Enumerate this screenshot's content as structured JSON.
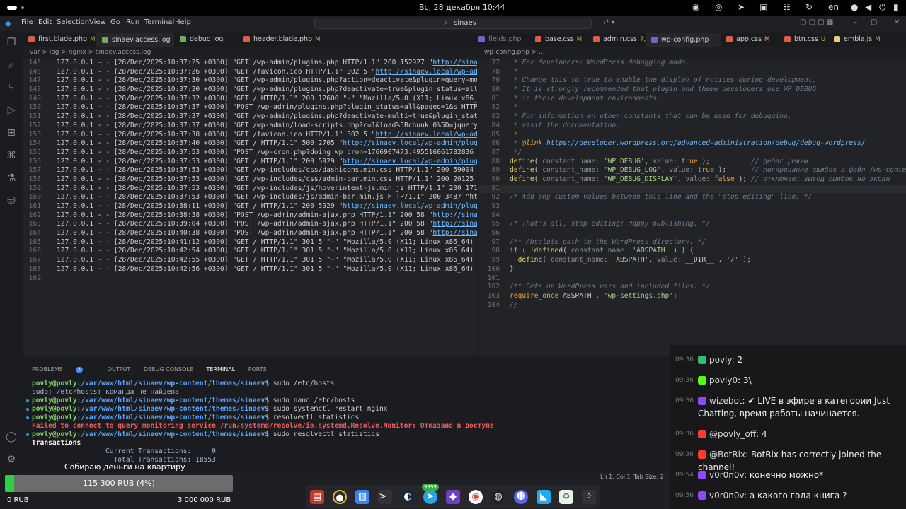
{
  "topbar": {
    "clock": "Вс, 28 декабря  10:44",
    "lang": "en"
  },
  "menu": [
    "File",
    "Edit",
    "Selection",
    "View",
    "Go",
    "Run",
    "Terminal",
    "Help"
  ],
  "search": {
    "text": "sinaev"
  },
  "tabs": [
    {
      "label": "first.blade.php",
      "mark": "M",
      "color": "#e05d44"
    },
    {
      "label": "sinaev.access.log",
      "mark": "",
      "color": "#7aa85a",
      "active": true
    },
    {
      "label": "debug.log",
      "mark": "",
      "color": "#7aa85a"
    },
    {
      "label": "header.blade.php",
      "mark": "M",
      "color": "#e05d44"
    },
    {
      "label": "fields.php",
      "mark": "",
      "color": "#7b5fc4"
    },
    {
      "label": "base.css",
      "mark": "M",
      "color": "#e05d44"
    },
    {
      "label": "admin.css",
      "mark": "7, M",
      "color": "#e05d44"
    },
    {
      "label": "wp-config.php",
      "mark": "",
      "color": "#7b5fc4",
      "active": true
    },
    {
      "label": "app.css",
      "mark": "M",
      "color": "#e05d44"
    },
    {
      "label": "btn.css",
      "mark": "U",
      "color": "#e05d44"
    },
    {
      "label": "embla.js",
      "mark": "M",
      "color": "#e8d06a"
    }
  ],
  "breadcrumb_left": "var  >  log  >  nginx  >  sinaev.access.log",
  "breadcrumb_right": "wp-config.php  >  ...",
  "log": {
    "start": 145,
    "lines": [
      "127.0.0.1 - - [28/Dec/2025:10:37:25 +0300] \"GET /wp-admin/plugins.php HTTP/1.1\" 200 152927 \"http://sinae",
      "127.0.0.1 - - [28/Dec/2025:10:37:26 +0300] \"GET /favicon.ico HTTP/1.1\" 302 5 \"http://sinaev.local/wp-adm",
      "127.0.0.1 - - [28/Dec/2025:10:37:30 +0300] \"GET /wp-admin/plugins.php?action=deactivate&plugin=query-mon",
      "127.0.0.1 - - [28/Dec/2025:10:37:30 +0300] \"GET /wp-admin/plugins.php?deactivate=true&plugin_status=all&",
      "127.0.0.1 - - [28/Dec/2025:10:37:32 +0300] \"GET / HTTP/1.1\" 200 12600 \"-\" \"Mozilla/5.0 (X11; Linux x86_6",
      "127.0.0.1 - - [28/Dec/2025:10:37:37 +0300] \"POST /wp-admin/plugins.php?plugin_status=all&paged=1&s HTTP/1.",
      "127.0.0.1 - - [28/Dec/2025:10:37:37 +0300] \"GET /wp-admin/plugins.php?deactivate-multi=true&plugin_statu",
      "127.0.0.1 - - [28/Dec/2025:10:37:37 +0300] \"GET /wp-admin/load-scripts.php?c=1&load%5Bchunk_0%5D=jquery-",
      "127.0.0.1 - - [28/Dec/2025:10:37:38 +0300] \"GET /favicon.ico HTTP/1.1\" 302 5 \"http://sinaev.local/wp-adm",
      "127.0.0.1 - - [28/Dec/2025:10:37:40 +0300] \"GET / HTTP/1.1\" 500 2705 \"http://sinaev.local/wp-admin/plug",
      "127.0.0.1 - - [28/Dec/2025:10:37:53 +0300] \"POST /wp-cron.php?doing_wp_cron=1766907473.495516061782836",
      "127.0.0.1 - - [28/Dec/2025:10:37:53 +0300] \"GET / HTTP/1.1\" 200 5929 \"http://sinaev.local/wp-admin/plug",
      "127.0.0.1 - - [28/Dec/2025:10:37:53 +0300] \"GET /wp-includes/css/dashicons.min.css HTTP/1.1\" 200 59004 \"",
      "127.0.0.1 - - [28/Dec/2025:10:37:53 +0300] \"GET /wp-includes/css/admin-bar.min.css HTTP/1.1\" 200 20125 \"",
      "127.0.0.1 - - [28/Dec/2025:10:37:53 +0300] \"GET /wp-includes/js/hoverintent-js.min.js HTTP/1.1\" 200 171",
      "127.0.0.1 - - [28/Dec/2025:10:37:53 +0300] \"GET /wp-includes/js/admin-bar.min.js HTTP/1.1\" 200 3487 \"ht",
      "127.0.0.1 - - [28/Dec/2025:10:38:11 +0300] \"GET / HTTP/1.1\" 200 5929 \"http://sinaev.local/wp-admin/plug",
      "127.0.0.1 - - [28/Dec/2025:10:38:38 +0300] \"POST /wp-admin/admin-ajax.php HTTP/1.1\" 200 58 \"http://sinae",
      "127.0.0.1 - - [28/Dec/2025:10:39:04 +0300] \"POST /wp-admin/admin-ajax.php HTTP/1.1\" 200 58 \"http://sinae",
      "127.0.0.1 - - [28/Dec/2025:10:40:38 +0300] \"POST /wp-admin/admin-ajax.php HTTP/1.1\" 200 58 \"http://sinae",
      "127.0.0.1 - - [28/Dec/2025:10:41:12 +0300] \"GET / HTTP/1.1\" 301 5 \"-\" \"Mozilla/5.0 (X11; Linux x86_64) A",
      "127.0.0.1 - - [28/Dec/2025:10:42:54 +0300] \"GET / HTTP/1.1\" 301 5 \"-\" \"Mozilla/5.0 (X11; Linux x86_64) A",
      "127.0.0.1 - - [28/Dec/2025:10:42:55 +0300] \"GET / HTTP/1.1\" 301 5 \"-\" \"Mozilla/5.0 (X11; Linux x86_64) A",
      "127.0.0.1 - - [28/Dec/2025:10:42:56 +0300] \"GET / HTTP/1.1\" 301 5 \"-\" \"Mozilla/5.0 (X11; Linux x86_64) A",
      ""
    ]
  },
  "code": {
    "start": 77,
    "lines": [
      {
        "t": "cm",
        "s": " * For developers: WordPress debugging mode."
      },
      {
        "t": "cm",
        "s": " *"
      },
      {
        "t": "cm",
        "s": " * Change this to true to enable the display of notices during development."
      },
      {
        "t": "cm",
        "s": " * It is strongly recommended that plugin and theme developers use WP_DEBUG"
      },
      {
        "t": "cm",
        "s": " * in their development environments."
      },
      {
        "t": "cm",
        "s": " *"
      },
      {
        "t": "cm",
        "s": " * For information on other constants that can be used for debugging,"
      },
      {
        "t": "cm",
        "s": " * visit the documentation."
      },
      {
        "t": "cm",
        "s": " *"
      },
      {
        "t": "link",
        "s": " * @link https://developer.wordpress.org/advanced-administration/debug/debug-wordpress/"
      },
      {
        "t": "cm",
        "s": " */"
      },
      {
        "t": "def",
        "s": "define( constant_name: 'WP_DEBUG', value: true );          // дебаг режим"
      },
      {
        "t": "def",
        "s": "define( constant_name: 'WP_DEBUG_LOG', value: true );      // логирование ошибок в файл /wp-conte"
      },
      {
        "t": "def",
        "s": "define( constant_name: 'WP_DEBUG_DISPLAY', value: false ); // отключает вывод ошибок на экран"
      },
      {
        "t": "cur",
        "s": ""
      },
      {
        "t": "cm",
        "s": "/* Add any custom values between this line and the \"stop editing\" line. */"
      },
      {
        "t": "",
        "s": ""
      },
      {
        "t": "",
        "s": ""
      },
      {
        "t": "cm",
        "s": "/* That's all, stop editing! Happy publishing. */"
      },
      {
        "t": "",
        "s": ""
      },
      {
        "t": "cm",
        "s": "/** Absolute path to the WordPress directory. */"
      },
      {
        "t": "code",
        "s": "if ( !defined( constant_name: 'ABSPATH' ) ) {"
      },
      {
        "t": "code",
        "s": "  define( constant_name: 'ABSPATH', value: __DIR__ . '/' );"
      },
      {
        "t": "code",
        "s": "}"
      },
      {
        "t": "",
        "s": ""
      },
      {
        "t": "cm",
        "s": "/** Sets up WordPress vars and included files. */"
      },
      {
        "t": "code",
        "s": "require_once ABSPATH . 'wp-settings.php';"
      },
      {
        "t": "cm",
        "s": "//"
      }
    ]
  },
  "panel_tabs": {
    "problems": "PROBLEMS",
    "problems_count": "7",
    "output": "OUTPUT",
    "debug": "DEBUG CONSOLE",
    "terminal": "TERMINAL",
    "ports": "PORTS"
  },
  "terminal": {
    "user": "povly@povly",
    "path": ":/var/www/html/sinaev/wp-content/themes/sinaev",
    "lines": [
      {
        "k": "prompt",
        "cmd": "$ sudo /etc/hosts",
        "bullet": false
      },
      {
        "k": "out",
        "s": "sudo: /etc/hosts: команда не найдена"
      },
      {
        "k": "prompt",
        "cmd": "$ sudo nano /etc/hosts",
        "bullet": true
      },
      {
        "k": "prompt",
        "cmd": "$ sudo systemctl restart nginx",
        "bullet": true
      },
      {
        "k": "prompt",
        "cmd": "$ resolvectl statistics",
        "bullet": true
      },
      {
        "k": "err",
        "s": "Failed to connect to query monitoring service /run/systemd/resolve/io.systemd.Resolve.Monitor: Отказано в доступе"
      },
      {
        "k": "prompt",
        "cmd": "$ sudo resolvectl statistics",
        "bullet": true
      },
      {
        "k": "bold",
        "s": "Transactions"
      },
      {
        "k": "out",
        "s": "                  Current Transactions:     0"
      },
      {
        "k": "out",
        "s": "                    Total Transactions: 18553"
      }
    ]
  },
  "statusbar": {
    "pos": "Ln 1, Col 1",
    "tab": "Tab Size: 2"
  },
  "chat": [
    {
      "ts": "09:36",
      "name": "povly",
      "text": ": 2",
      "color": "#2fbf71"
    },
    {
      "ts": "09:36",
      "name": "povly0",
      "text": ": 3\\",
      "color": "#53fc18"
    },
    {
      "ts": "09:36",
      "name": "wizebot",
      "text": ": ✔ LIVE в эфире в категории Just Chatting, время работы начинается.",
      "color": "#9146ff"
    },
    {
      "ts": "09:36",
      "name": "@povly_off",
      "text": ": 4",
      "color": "#ff3b30"
    },
    {
      "ts": "09:36",
      "name": "@BotRix",
      "text": ": BotRix has correctly joined the channel!",
      "color": "#ff3b30"
    },
    {
      "ts": "09:54",
      "name": "v0r0n0v",
      "text": ": конечно можно*",
      "color": "#9146ff"
    },
    {
      "ts": "09:56",
      "name": "v0r0n0v",
      "text": ": а какого года книга ?",
      "color": "#9146ff"
    }
  ],
  "donation": {
    "title": "Собираю деньги на квартиру",
    "amount": "115 300 RUB (4%)",
    "progress": 0.04,
    "min": "0 RUB",
    "max": "3 000 000 RUB"
  },
  "dock": {
    "badge": "9999"
  }
}
